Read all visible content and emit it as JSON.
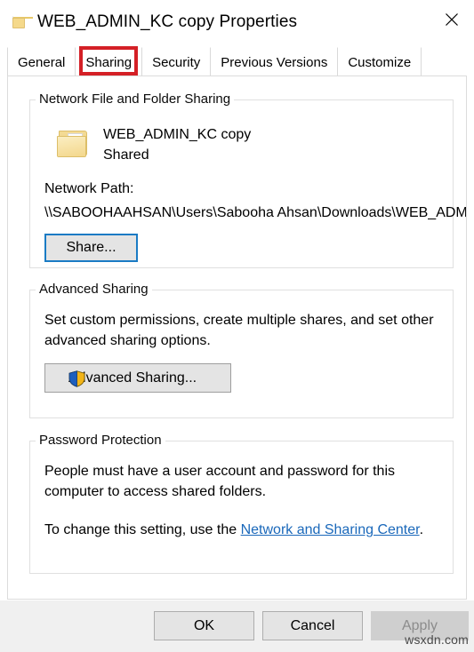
{
  "window": {
    "title": "WEB_ADMIN_KC copy Properties",
    "folder_icon": "folder-icon",
    "close_icon": "close-icon"
  },
  "tabs": [
    {
      "label": "General",
      "selected": false
    },
    {
      "label": "Sharing",
      "selected": true,
      "highlighted": true
    },
    {
      "label": "Security",
      "selected": false
    },
    {
      "label": "Previous Versions",
      "selected": false
    },
    {
      "label": "Customize",
      "selected": false
    }
  ],
  "highlight_color": "#d42026",
  "network_group": {
    "title": "Network File and Folder Sharing",
    "folder_icon": "folder-open-icon",
    "folder_name": "WEB_ADMIN_KC copy",
    "share_state": "Shared",
    "path_label": "Network Path:",
    "path_value": "\\\\SABOOHAAHSAN\\Users\\Sabooha Ahsan\\Downloads\\WEB_ADMIN_KC copy",
    "share_button": "Share..."
  },
  "advanced_group": {
    "title": "Advanced Sharing",
    "description": "Set custom permissions, create multiple shares, and set other advanced sharing options.",
    "button_label": "Advanced Sharing...",
    "button_icon": "uac-shield-icon"
  },
  "password_group": {
    "title": "Password Protection",
    "description": "People must have a user account and password for this computer to access shared folders.",
    "setting_prefix": "To change this setting, use the ",
    "link_label": "Network and Sharing Center",
    "setting_suffix": ".",
    "link_color": "#1a68ba"
  },
  "footer": {
    "ok": "OK",
    "cancel": "Cancel",
    "apply": "Apply",
    "apply_disabled": true
  },
  "watermark": "wsxdn.com"
}
